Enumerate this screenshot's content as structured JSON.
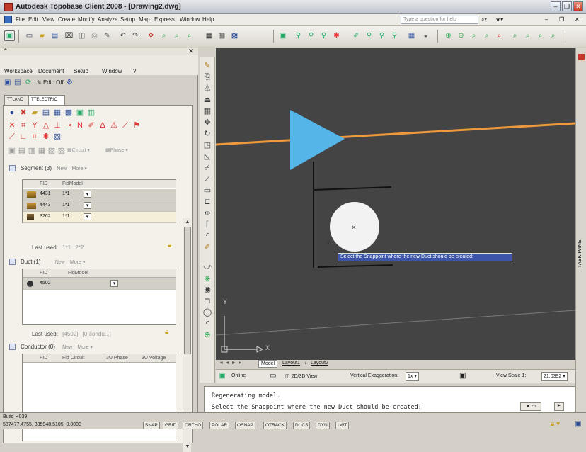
{
  "window": {
    "title": "Autodesk Topobase Client 2008 - [Drawing2.dwg]"
  },
  "menubar": {
    "items": [
      "File",
      "Edit",
      "View",
      "Create",
      "Modify",
      "Analyze",
      "Setup",
      "Map",
      "Express",
      "Window",
      "Help"
    ],
    "help_placeholder": "Type a question for help"
  },
  "leftpanel": {
    "menu": [
      "Workspace",
      "Document",
      "Setup",
      "Window",
      "?"
    ],
    "edit_off": "Edit: Off",
    "tabs": [
      "TTLAND",
      "TTELECTRIC"
    ],
    "circuit_label": "Circuit",
    "phase_label": "Phase",
    "segment": {
      "label": "Segment (3)",
      "new": "New",
      "more": "More",
      "headers": [
        "FID",
        "FidModel"
      ],
      "rows": [
        {
          "pid": "4431",
          "model": "1*1"
        },
        {
          "pid": "4443",
          "model": "1*1"
        },
        {
          "pid": "3262",
          "model": "1*1"
        }
      ],
      "last_used_label": "Last used:",
      "last_used": [
        "1*1",
        "2*2"
      ]
    },
    "duct": {
      "label": "Duct (1)",
      "new": "New",
      "more": "More",
      "headers": [
        "FID",
        "FidModel"
      ],
      "rows": [
        {
          "pid": "4502",
          "model": ""
        }
      ],
      "last_used_label": "Last used:",
      "last_used": [
        "[4502]",
        "[0-condu...]"
      ]
    },
    "conductor": {
      "label": "Conductor (0)",
      "new": "New",
      "more": "More",
      "headers": [
        "FID",
        "Fid Circuit",
        "3U Phase",
        "3U Voltage"
      ]
    }
  },
  "drawing": {
    "tooltip": "Select the Snappoint where the new Duct should be created:",
    "ucs_x": "X",
    "ucs_y": "Y"
  },
  "layout_tabs": [
    "Model",
    "Layout1",
    "Layout2"
  ],
  "statusstrip": {
    "online": "Online",
    "view": "2D/3D View",
    "vexag_label": "Vertical Exaggeration:",
    "vexag_value": "1x",
    "viewscale_label": "View Scale 1:",
    "viewscale_value": "21.0392"
  },
  "command": {
    "line1": "Regenerating model.",
    "line2": "Select the Snappoint where the new Duct should be created:"
  },
  "taskpane": {
    "label": "TASK PANE"
  },
  "bottom": {
    "build": "Build H039",
    "coords": "587477.4755, 335948.5105, 0.0000",
    "toggles": [
      "SNAP",
      "GRID",
      "ORTHO",
      "POLAR",
      "OSNAP",
      "OTRACK",
      "DUCS",
      "DYN",
      "LWT"
    ]
  },
  "colors": {
    "accent_orange": "#ee9a3c",
    "triangle_blue": "#55b5e8",
    "canvas_bg": "#444444"
  }
}
